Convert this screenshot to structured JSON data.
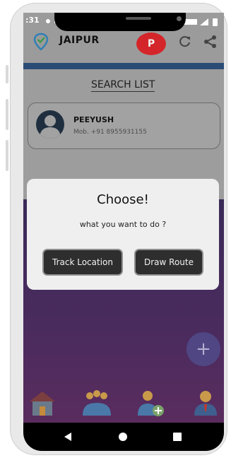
{
  "status_bar": {
    "time": ":31"
  },
  "app_bar": {
    "title": "JAIPUR",
    "profile_initial": "P"
  },
  "search": {
    "header": "SEARCH LIST"
  },
  "contacts": [
    {
      "name": "PEEYUSH",
      "phone": "Mob. +91 8955931155"
    }
  ],
  "dialog": {
    "title": "Choose!",
    "message": "what you want to do ?",
    "buttons": {
      "track": "Track Location",
      "route": "Draw Route"
    }
  },
  "fab": {
    "label": "+"
  },
  "colors": {
    "accent_strip": "#2b4b77",
    "profile_badge": "#d4262a",
    "purple_bg": "#4b2b5e",
    "fab": "#4f4683",
    "dialog_bg": "#efefef",
    "dialog_button": "#2e2e2e"
  },
  "icons": {
    "app_logo": "location-pin-check-icon",
    "refresh": "refresh-icon",
    "share": "share-icon",
    "nav_home": "home-icon",
    "nav_group": "group-icon",
    "nav_add_user": "add-user-icon",
    "nav_profile": "profile-icon",
    "nav_back": "back-triangle-icon",
    "nav_home_circle": "home-circle-icon",
    "nav_recents": "recents-square-icon"
  }
}
